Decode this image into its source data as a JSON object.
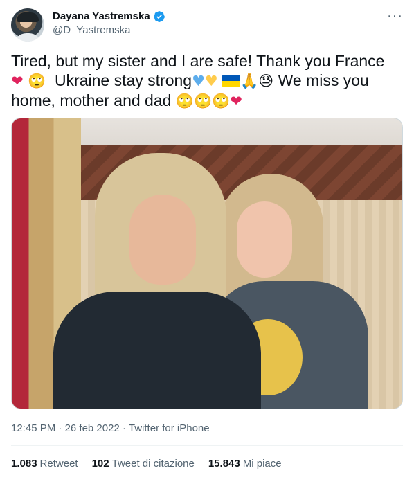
{
  "author": {
    "display_name": "Dayana Yastremska",
    "handle": "@D_Yastremska",
    "verified_icon": "verified-badge-icon",
    "more_label": "···"
  },
  "tweet": {
    "line1": "Tired, but my sister and I are safe! Thank you France",
    "line2_text": "Ukraine stay strong",
    "line2_tail": "We miss you",
    "line3_text": "home, mother and dad",
    "emoji": {
      "red_heart": "❤",
      "face_roll": "🙄",
      "blue_heart": "♥",
      "yellow_heart": "♥",
      "folded_hands": "🙏",
      "downcast_face": "😓"
    }
  },
  "media": {
    "description_icon": "photo-media"
  },
  "meta": {
    "time": "12:45 PM",
    "separator": "·",
    "date": "26 feb 2022",
    "source": "Twitter for iPhone"
  },
  "stats": {
    "retweets_count": "1.083",
    "retweets_label": "Retweet",
    "quotes_count": "102",
    "quotes_label": "Tweet di citazione",
    "likes_count": "15.843",
    "likes_label": "Mi piace"
  },
  "colors": {
    "text": "#0f1419",
    "secondary": "#536471",
    "verified": "#1d9bf0",
    "heart": "#e0245e",
    "ukraine_blue": "#0057b7",
    "ukraine_yellow": "#ffd700"
  }
}
